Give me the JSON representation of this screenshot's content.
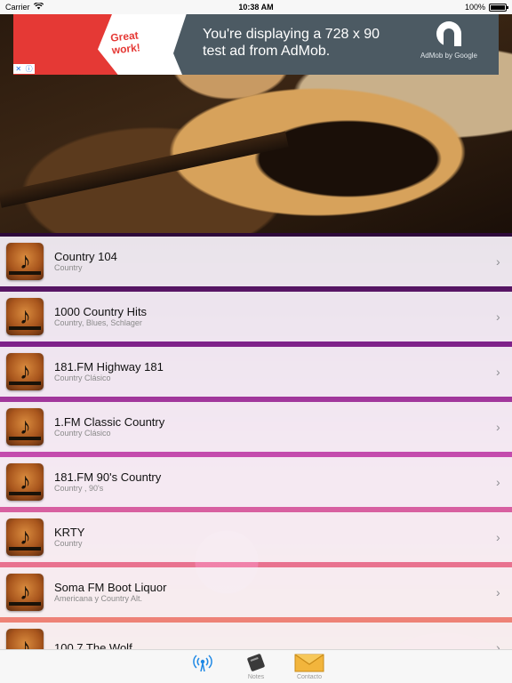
{
  "status": {
    "carrier": "Carrier",
    "time": "10:38 AM",
    "battery": "100%",
    "wifi_icon": "wifi-icon",
    "battery_icon": "battery-icon"
  },
  "ad": {
    "badge": "Great\nwork!",
    "text_line1": "You're displaying a 728 x 90",
    "text_line2": "test ad from AdMob.",
    "by": "AdMob by Google",
    "choices_icon": "adchoices-icon"
  },
  "stations": [
    {
      "title": "Country 104",
      "subtitle": "Country"
    },
    {
      "title": "1000 Country Hits",
      "subtitle": "Country, Blues, Schlager"
    },
    {
      "title": "181.FM Highway 181",
      "subtitle": "Country Clásico"
    },
    {
      "title": "1.FM Classic Country",
      "subtitle": "Country Clásico"
    },
    {
      "title": "181.FM 90's Country",
      "subtitle": "Country , 90's"
    },
    {
      "title": "KRTY",
      "subtitle": "Country"
    },
    {
      "title": "Soma FM Boot Liquor",
      "subtitle": "Americana y Country Alt."
    },
    {
      "title": "100.7 The Wolf",
      "subtitle": ""
    }
  ],
  "tabs": [
    {
      "label": "",
      "icon": "radio-antenna-icon"
    },
    {
      "label": "Notes",
      "icon": "notes-icon"
    },
    {
      "label": "Contacto",
      "icon": "mail-icon"
    }
  ],
  "colors": {
    "status_bg": "#f7f7f7",
    "tab_active": "#1e88e5",
    "ad_red": "#e53935",
    "ad_gray": "#4c5a63"
  }
}
